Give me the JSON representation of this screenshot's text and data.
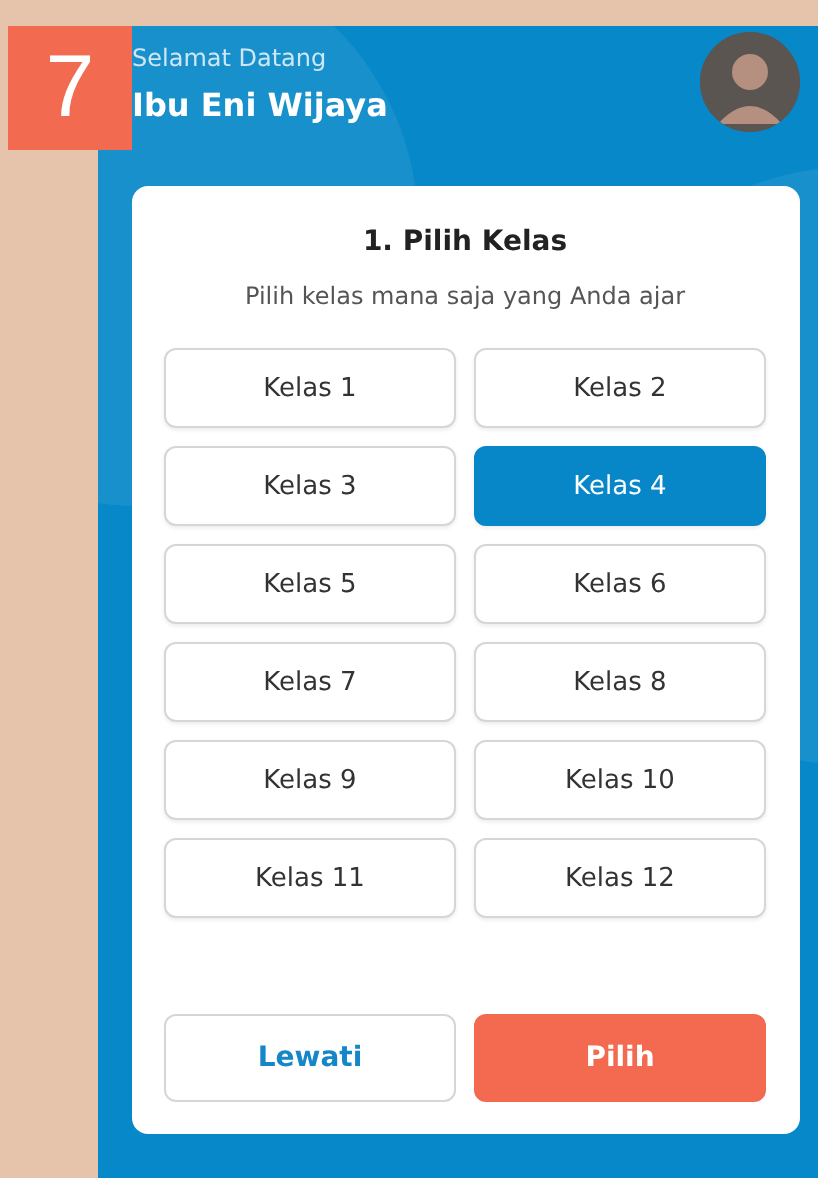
{
  "step_badge": "7",
  "header": {
    "greeting": "Selamat Datang",
    "name": "Ibu Eni Wijaya"
  },
  "card": {
    "title": "1. Pilih Kelas",
    "subtitle": "Pilih kelas mana saja yang Anda ajar",
    "classes": [
      {
        "label": "Kelas 1",
        "selected": false
      },
      {
        "label": "Kelas 2",
        "selected": false
      },
      {
        "label": "Kelas 3",
        "selected": false
      },
      {
        "label": "Kelas 4",
        "selected": true
      },
      {
        "label": "Kelas 5",
        "selected": false
      },
      {
        "label": "Kelas 6",
        "selected": false
      },
      {
        "label": "Kelas 7",
        "selected": false
      },
      {
        "label": "Kelas 8",
        "selected": false
      },
      {
        "label": "Kelas 9",
        "selected": false
      },
      {
        "label": "Kelas 10",
        "selected": false
      },
      {
        "label": "Kelas 11",
        "selected": false
      },
      {
        "label": "Kelas 12",
        "selected": false
      }
    ],
    "buttons": [
      {
        "label": "Lewati",
        "kind": "secondary"
      },
      {
        "label": "Pilih",
        "kind": "primary"
      }
    ]
  }
}
